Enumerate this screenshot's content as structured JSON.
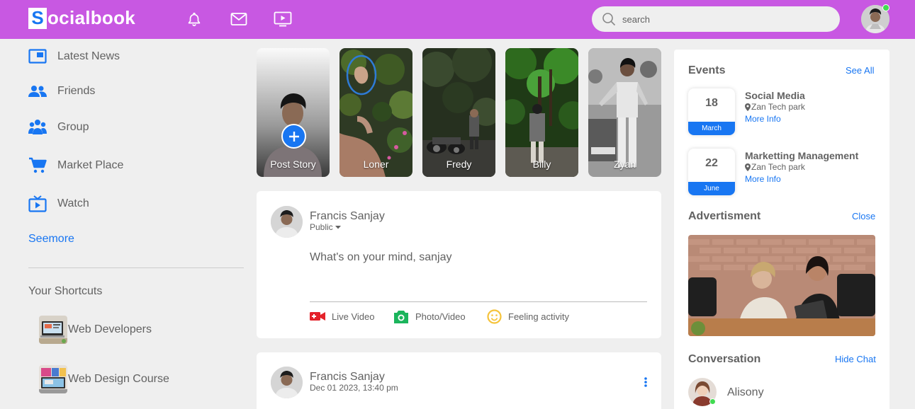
{
  "navbar": {
    "logo_letter": "S",
    "logo_text": "ocialbook",
    "search_placeholder": "search",
    "bg_color": "#c858e2",
    "icons": [
      "bell-icon",
      "mail-icon",
      "video-icon"
    ]
  },
  "left_sidebar": {
    "items": [
      {
        "label": "Latest News",
        "icon": "news-icon"
      },
      {
        "label": "Friends",
        "icon": "friends-icon"
      },
      {
        "label": "Group",
        "icon": "group-icon"
      },
      {
        "label": "Market Place",
        "icon": "cart-icon"
      },
      {
        "label": "Watch",
        "icon": "tv-icon"
      }
    ],
    "seemore": "Seemore",
    "shortcuts_title": "Your Shortcuts",
    "shortcuts": [
      {
        "label": "Web Developers"
      },
      {
        "label": "Web Design Course"
      }
    ]
  },
  "stories": [
    {
      "label": "Post Story"
    },
    {
      "label": "Loner"
    },
    {
      "label": "Fredy"
    },
    {
      "label": "Billy"
    },
    {
      "label": "Zyan"
    }
  ],
  "create_post": {
    "user_name": "Francis Sanjay",
    "visibility": "Public",
    "prompt": "What's on your mind, sanjay",
    "actions": [
      {
        "label": "Live Video",
        "icon": "live-video-icon"
      },
      {
        "label": "Photo/Video",
        "icon": "camera-icon"
      },
      {
        "label": "Feeling activity",
        "icon": "smile-icon"
      }
    ]
  },
  "post": {
    "user_name": "Francis Sanjay",
    "timestamp": "Dec 01 2023, 13:40 pm"
  },
  "right_sidebar": {
    "events_title": "Events",
    "see_all": "See All",
    "events": [
      {
        "day": "18",
        "month": "March",
        "title": "Social Media",
        "location": "Zan Tech park",
        "more": "More Info"
      },
      {
        "day": "22",
        "month": "June",
        "title": "Marketting Management",
        "location": "Zan Tech park",
        "more": "More Info"
      }
    ],
    "ad_title": "Advertisment",
    "ad_close": "Close",
    "conversation_title": "Conversation",
    "hide_chat": "Hide Chat",
    "contacts": [
      {
        "name": "Alisony"
      }
    ]
  },
  "colors": {
    "accent": "#1876f2",
    "online": "#41db51",
    "text": "#626262"
  }
}
